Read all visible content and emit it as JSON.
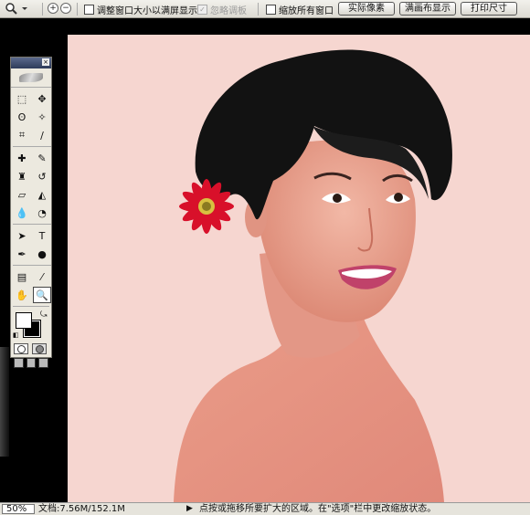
{
  "options_bar": {
    "tool_icon": "zoom-magnifier-icon",
    "zoom_in_icon": "zoom-in-icon",
    "zoom_out_icon": "zoom-out-icon",
    "resize_windows_label": "调整窗口大小以满屏显示",
    "ignore_palettes_label": "忽略调板",
    "zoom_all_windows_label": "缩放所有窗口",
    "actual_pixels_label": "实际像素",
    "fit_screen_label": "满画布显示",
    "print_size_label": "打印尺寸"
  },
  "toolbox": {
    "tools": [
      {
        "name": "marquee-icon",
        "glyph": "⬚"
      },
      {
        "name": "move-icon",
        "glyph": "✥"
      },
      {
        "name": "lasso-icon",
        "glyph": "ʘ"
      },
      {
        "name": "magic-wand-icon",
        "glyph": "✧"
      },
      {
        "name": "crop-icon",
        "glyph": "⌗"
      },
      {
        "name": "slice-icon",
        "glyph": "∕"
      },
      {
        "name": "healing-brush-icon",
        "glyph": "✚"
      },
      {
        "name": "brush-icon",
        "glyph": "✎"
      },
      {
        "name": "clone-stamp-icon",
        "glyph": "♜"
      },
      {
        "name": "history-brush-icon",
        "glyph": "↺"
      },
      {
        "name": "eraser-icon",
        "glyph": "▱"
      },
      {
        "name": "paint-bucket-icon",
        "glyph": "◭"
      },
      {
        "name": "blur-icon",
        "glyph": "💧"
      },
      {
        "name": "dodge-icon",
        "glyph": "◔"
      },
      {
        "name": "path-selection-icon",
        "glyph": "➤"
      },
      {
        "name": "type-icon",
        "glyph": "T"
      },
      {
        "name": "pen-icon",
        "glyph": "✒"
      },
      {
        "name": "ellipse-shape-icon",
        "glyph": "●"
      },
      {
        "name": "notes-icon",
        "glyph": "▤"
      },
      {
        "name": "eyedropper-icon",
        "glyph": "⁄"
      },
      {
        "name": "hand-icon",
        "glyph": "✋"
      },
      {
        "name": "zoom-icon",
        "glyph": "🔍"
      }
    ],
    "selected_tool": "zoom-icon"
  },
  "status_bar": {
    "zoom": "50%",
    "doc_info": "文档:7.56M/152.1M",
    "hint": "点按或拖移所要扩大的区域。在\"选项\"栏中更改缩放状态。"
  },
  "colors": {
    "canvas_bg": "#f6d6d0",
    "hair": "#111111",
    "skin": "#e8a08e",
    "flower": "#d8102a",
    "lips": "#c0426a"
  }
}
